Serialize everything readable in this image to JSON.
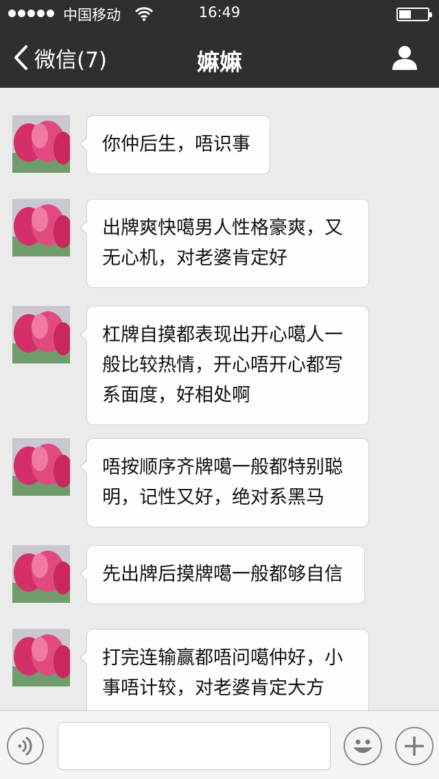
{
  "status_bar": {
    "carrier": "中国移动",
    "time": "16:49"
  },
  "nav": {
    "back_label": "微信(7)",
    "title": "嫲嫲"
  },
  "messages": [
    {
      "text": "你仲后生，唔识事"
    },
    {
      "text": "出牌爽快噶男人性格豪爽，又无心机，对老婆肯定好"
    },
    {
      "text": "杠牌自摸都表现出开心噶人一般比较热情，开心唔开心都写系面度，好相处啊"
    },
    {
      "text": "唔按顺序齐牌噶一般都特别聪明，记性又好，绝对系黑马"
    },
    {
      "text": "先出牌后摸牌噶一般都够自信"
    },
    {
      "text": "打完连输赢都唔问噶仲好，小事唔计较，对老婆肯定大方"
    }
  ],
  "icons": {
    "back": "chevron-left-icon",
    "profile": "person-icon",
    "voice": "voice-icon",
    "emoji": "smiley-icon",
    "plus": "plus-icon"
  },
  "colors": {
    "header_bg": "#2f2f33",
    "chat_bg": "#ebebeb",
    "bubble_bg": "#fdfdfd"
  }
}
